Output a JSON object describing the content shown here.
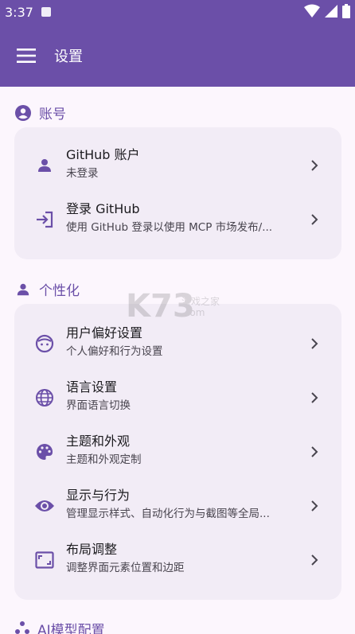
{
  "status": {
    "time": "3:37"
  },
  "appbar": {
    "title": "设置"
  },
  "sections": {
    "account": {
      "label": "账号",
      "items": [
        {
          "title": "GitHub 账户",
          "subtitle": "未登录"
        },
        {
          "title": "登录 GitHub",
          "subtitle": "使用 GitHub 登录以使用 MCP 市场发布/..."
        }
      ]
    },
    "personalization": {
      "label": "个性化",
      "items": [
        {
          "title": "用户偏好设置",
          "subtitle": "个人偏好和行为设置"
        },
        {
          "title": "语言设置",
          "subtitle": "界面语言切换"
        },
        {
          "title": "主题和外观",
          "subtitle": "主题和外观定制"
        },
        {
          "title": "显示与行为",
          "subtitle": "管理显示样式、自动化行为与截图等全局..."
        },
        {
          "title": "布局调整",
          "subtitle": "调整界面元素位置和边距"
        }
      ]
    },
    "ai": {
      "label": "AI模型配置"
    }
  },
  "watermark": {
    "logo": "K73",
    "name": "游戏之家",
    "url": ".com"
  },
  "colors": {
    "primary": "#6b4fa8",
    "background": "#fcf6fd",
    "card": "#f2ecf6"
  }
}
